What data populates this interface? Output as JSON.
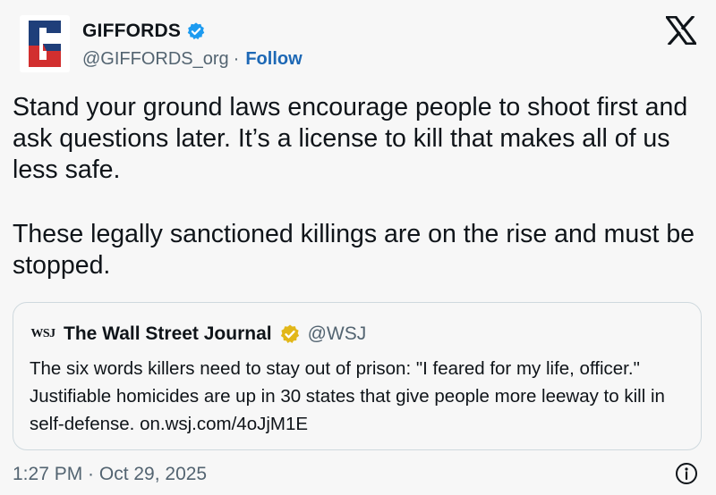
{
  "author": {
    "display_name": "GIFFORDS",
    "handle": "@GIFFORDS_org",
    "separator": "·",
    "follow_label": "Follow",
    "logo_letter": "G"
  },
  "tweet": {
    "paragraphs": [
      "Stand your ground laws encourage people to shoot first and ask questions later. It’s a license to kill that makes all of us less safe.",
      "These legally sanctioned killings are on the rise and must be stopped."
    ]
  },
  "quote": {
    "logo_text": "WSJ",
    "display_name": "The Wall Street Journal",
    "handle": "@WSJ",
    "text": "The six words killers need to stay out of prison: \"I feared for my life, officer.\" Justifiable homicides are up in 30 states that give people more leeway to kill in self-defense. on.wsj.com/4oJjM1E"
  },
  "timestamp": "1:27 PM · Oct 29, 2025",
  "icons": {
    "brand": "x-logo-icon",
    "verified_author": "verified-blue-check-icon",
    "verified_quote": "verified-gold-check-icon",
    "info": "info-icon"
  },
  "colors": {
    "follow": "#1d68b5",
    "verified_blue": "#1d9bf0",
    "verified_gold": "#e2b719",
    "logo_blue": "#1f3f7a",
    "logo_red": "#d22f2f"
  }
}
